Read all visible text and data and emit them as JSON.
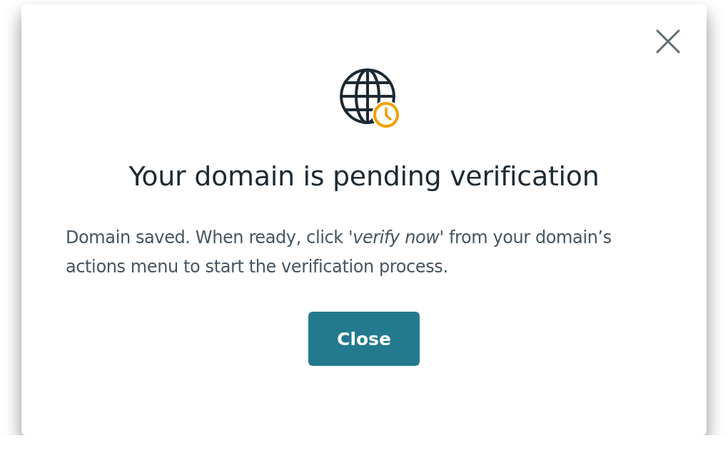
{
  "dialog": {
    "title": "Your domain is pending verification",
    "message": "Domain saved. When ready, click *'verify now'* from your domain’s actions menu to start the verification process.",
    "buttons": [
      {
        "label": "Close",
        "kind": "primary"
      }
    ]
  }
}
